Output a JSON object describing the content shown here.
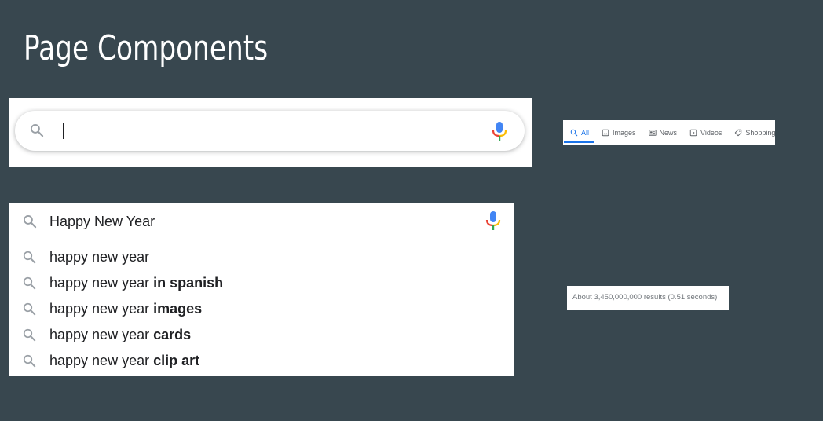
{
  "slide": {
    "title": "Page Components"
  },
  "empty_search": {
    "value": ""
  },
  "tabs": [
    {
      "label": "All",
      "icon": "search-icon",
      "active": true
    },
    {
      "label": "Images",
      "icon": "image-icon"
    },
    {
      "label": "News",
      "icon": "news-icon"
    },
    {
      "label": "Videos",
      "icon": "play-icon"
    },
    {
      "label": "Shopping",
      "icon": "tag-icon"
    }
  ],
  "autocomplete": {
    "query": "Happy New Year",
    "suggestions": [
      {
        "base": "happy new year",
        "bold": ""
      },
      {
        "base": "happy new year ",
        "bold": "in spanish"
      },
      {
        "base": "happy new year ",
        "bold": "images"
      },
      {
        "base": "happy new year ",
        "bold": "cards"
      },
      {
        "base": "happy new year ",
        "bold": "clip art"
      }
    ]
  },
  "result_stats": {
    "text": "About 3,450,000,000 results (0.51 seconds)"
  },
  "colors": {
    "background": "#38474f",
    "accent": "#1a73e8",
    "mic_blue": "#4285f4",
    "mic_red": "#ea4335",
    "mic_yellow": "#fbbc04",
    "mic_green": "#34a853"
  }
}
